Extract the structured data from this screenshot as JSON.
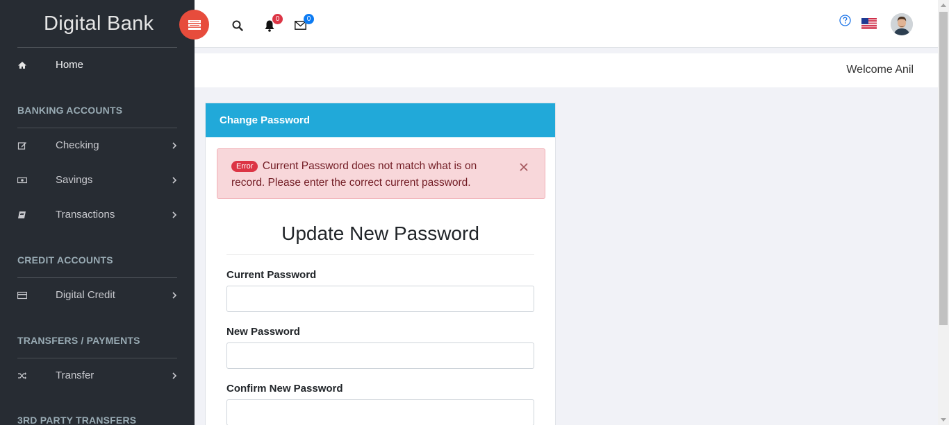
{
  "brand": {
    "light": "Digital",
    "bold": "Bank"
  },
  "header": {
    "notifications_count": "0",
    "messages_count": "0"
  },
  "sidebar": {
    "home": {
      "label": "Home",
      "icon": "home-icon"
    },
    "sections": [
      {
        "title": "BANKING ACCOUNTS",
        "items": [
          {
            "label": "Checking",
            "icon": "edit-icon"
          },
          {
            "label": "Savings",
            "icon": "money-icon"
          },
          {
            "label": "Transactions",
            "icon": "book-icon"
          }
        ]
      },
      {
        "title": "CREDIT ACCOUNTS",
        "items": [
          {
            "label": "Digital Credit",
            "icon": "credit-card-icon"
          }
        ]
      },
      {
        "title": "TRANSFERS / PAYMENTS",
        "items": [
          {
            "label": "Transfer",
            "icon": "shuffle-icon"
          }
        ]
      },
      {
        "title": "3RD PARTY TRANSFERS",
        "items": []
      }
    ]
  },
  "welcome": "Welcome Anil",
  "card": {
    "header": "Change Password",
    "alert": {
      "badge": "Error",
      "message": "Current Password does not match what is on record. Please enter the correct current password."
    },
    "form_title": "Update New Password",
    "fields": [
      {
        "label": "Current Password",
        "value": ""
      },
      {
        "label": "New Password",
        "value": ""
      },
      {
        "label": "Confirm New Password",
        "value": ""
      }
    ]
  },
  "colors": {
    "sidebar_bg": "#272c33",
    "toggle_bg": "#e74c3c",
    "card_header_bg": "#21a9d9",
    "alert_bg": "#f8d7da"
  }
}
